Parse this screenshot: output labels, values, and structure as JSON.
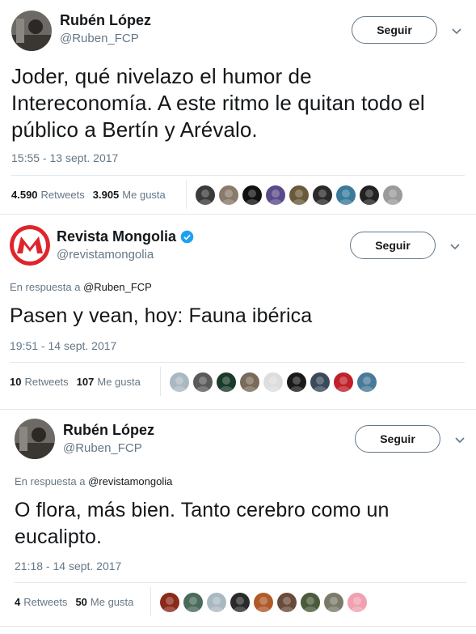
{
  "tweets": [
    {
      "author_name": "Rubén López",
      "author_handle": "@Ruben_FCP",
      "follow_label": "Seguir",
      "text_lines": [
        "Joder, qué nivelazo el humor de",
        "Intereconomía. A este ritmo le quitan todo el",
        "público a Bertín y Arévalo."
      ],
      "timestamp": "15:55 - 13 sept. 2017",
      "retweets_count": "4.590",
      "retweets_label": "Retweets",
      "likes_count": "3.905",
      "likes_label": "Me gusta",
      "liker_colors": [
        "#3a3a3a",
        "#8a7a6a",
        "#111111",
        "#5a4a8a",
        "#6a5a3a",
        "#2a2a2a",
        "#3a7a9a",
        "#222222",
        "#9a9a9a"
      ]
    },
    {
      "author_name": "Revista Mongolia",
      "author_handle": "@revistamongolia",
      "follow_label": "Seguir",
      "reply_prefix": "En respuesta a",
      "reply_to": "@Ruben_FCP",
      "text_lines": [
        "Pasen y vean, hoy: Fauna ibérica"
      ],
      "timestamp": "19:51 - 14 sept. 2017",
      "retweets_count": "10",
      "retweets_label": "Retweets",
      "likes_count": "107",
      "likes_label": "Me gusta",
      "liker_colors": [
        "#aab8c2",
        "#5a5a5a",
        "#1a3a2a",
        "#7a6a5a",
        "#dddddd",
        "#1a1a1a",
        "#3a4a5a",
        "#c0202a",
        "#4a7a9a"
      ]
    },
    {
      "author_name": "Rubén López",
      "author_handle": "@Ruben_FCP",
      "follow_label": "Seguir",
      "reply_prefix": "En respuesta a",
      "reply_to": "@revistamongolia",
      "text_lines": [
        "O flora, más bien. Tanto cerebro como un",
        "eucalipto."
      ],
      "timestamp": "21:18 - 14 sept. 2017",
      "retweets_count": "4",
      "retweets_label": "Retweets",
      "likes_count": "50",
      "likes_label": "Me gusta",
      "liker_colors": [
        "#8a2a1a",
        "#4a6a5a",
        "#aab8c2",
        "#2a2a2a",
        "#b05a2a",
        "#6a4a3a",
        "#4a5a3a",
        "#7a7a6a",
        "#f0a0b0"
      ]
    }
  ],
  "colors": {
    "verified": "#1da1f2",
    "brand_red": "#e0242c",
    "muted": "#657786"
  }
}
